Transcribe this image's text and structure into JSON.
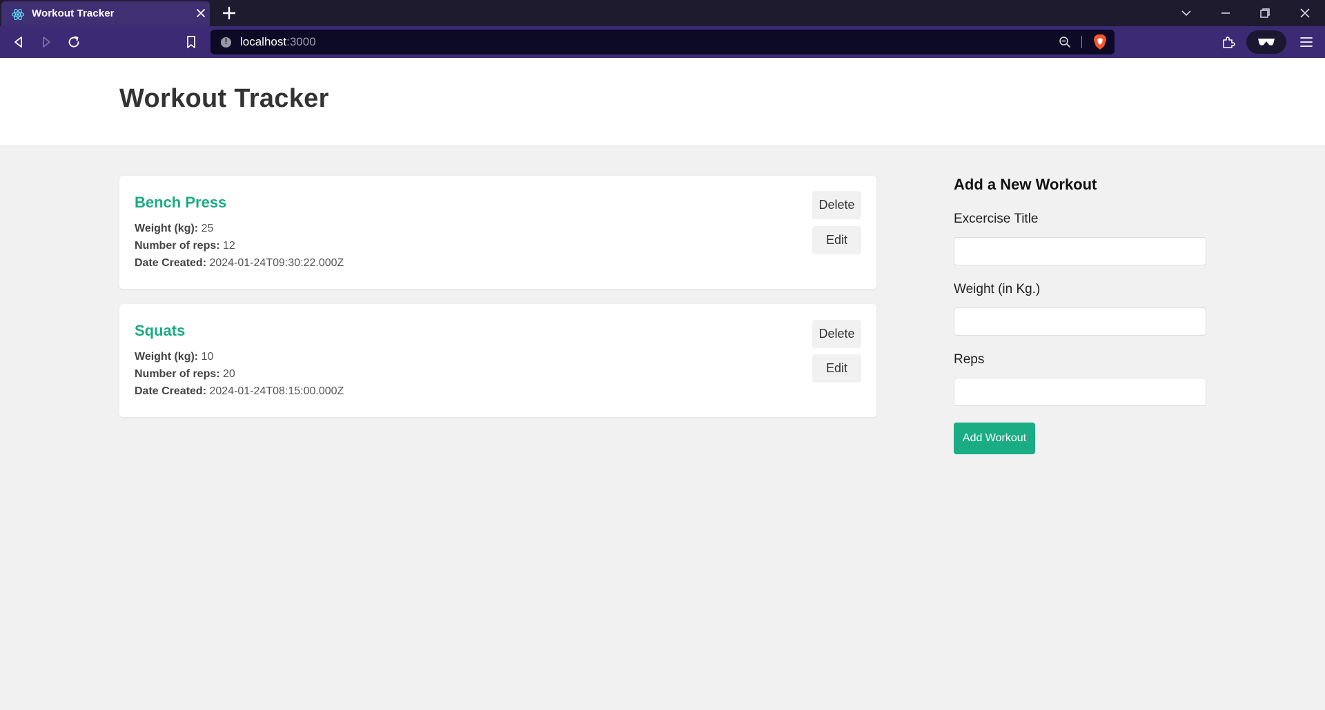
{
  "browser": {
    "tab_title": "Workout Tracker",
    "url_host": "localhost",
    "url_port": ":3000"
  },
  "app": {
    "title": "Workout Tracker"
  },
  "workouts": [
    {
      "title": "Bench Press",
      "weight_label": "Weight (kg):",
      "weight": "25",
      "reps_label": "Number of reps:",
      "reps": "12",
      "date_label": "Date Created:",
      "date": "2024-01-24T09:30:22.000Z",
      "delete_label": "Delete",
      "edit_label": "Edit"
    },
    {
      "title": "Squats",
      "weight_label": "Weight (kg):",
      "weight": "10",
      "reps_label": "Number of reps:",
      "reps": "20",
      "date_label": "Date Created:",
      "date": "2024-01-24T08:15:00.000Z",
      "delete_label": "Delete",
      "edit_label": "Edit"
    }
  ],
  "form": {
    "heading": "Add a New Workout",
    "title_label": "Excercise Title",
    "title_value": "",
    "weight_label": "Weight (in Kg.)",
    "weight_value": "",
    "reps_label": "Reps",
    "reps_value": "",
    "submit_label": "Add Workout"
  },
  "colors": {
    "accent": "#1aac83",
    "tab_bar": "#1e1b2e",
    "toolbar": "#3c2a74",
    "page_bg": "#f1f1f1"
  },
  "icons": {
    "tab_favicon": "react-atom-icon",
    "tab_close": "close-icon",
    "new_tab": "plus-icon",
    "back": "back-arrow-icon",
    "forward": "forward-arrow-icon",
    "reload": "reload-icon",
    "bookmark": "bookmark-icon",
    "site_info": "info-icon",
    "zoom": "zoom-icon",
    "shields": "brave-shields-icon",
    "extensions": "puzzle-icon",
    "wallet": "wallet-glasses-icon",
    "menu": "hamburger-menu-icon"
  }
}
